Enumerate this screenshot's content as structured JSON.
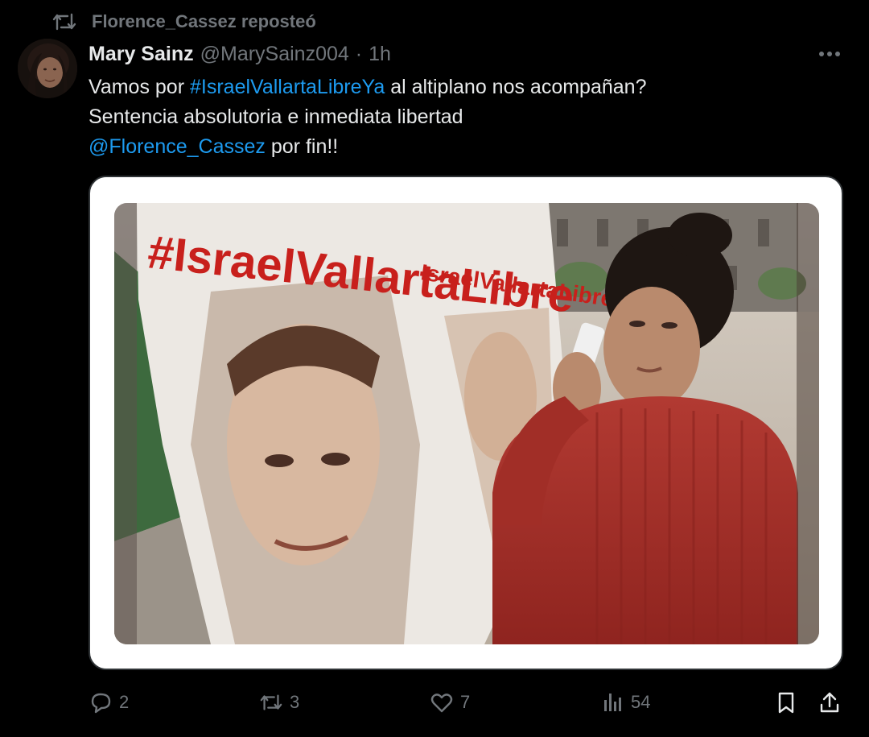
{
  "repost": {
    "icon": "repost-icon",
    "label": "Florence_Cassez reposteó"
  },
  "author": {
    "name": "Mary Sainz",
    "handle": "@MarySainz004",
    "separator": "·",
    "time": "1h",
    "avatar_icon": "avatar-photo"
  },
  "tweet": {
    "line1_prefix": "Vamos por ",
    "line1_hashtag": "#IsraelVallartaLibreYa",
    "line1_suffix": " al altiplano nos acompañan?",
    "line2": "Sentencia absolutoria e inmediata libertad",
    "line3_mention": "@Florence_Cassez",
    "line3_suffix": " por fin!!"
  },
  "media": {
    "banner_text_large": "#IsraelVallartaLibre",
    "banner_text_small": "IsraelVallartaLibre"
  },
  "actions": {
    "replies": "2",
    "reposts": "3",
    "likes": "7",
    "views": "54"
  },
  "colors": {
    "background": "#000000",
    "text": "#e7e9ea",
    "muted": "#71767b",
    "link": "#1d9bf0",
    "border": "#2f3336"
  }
}
